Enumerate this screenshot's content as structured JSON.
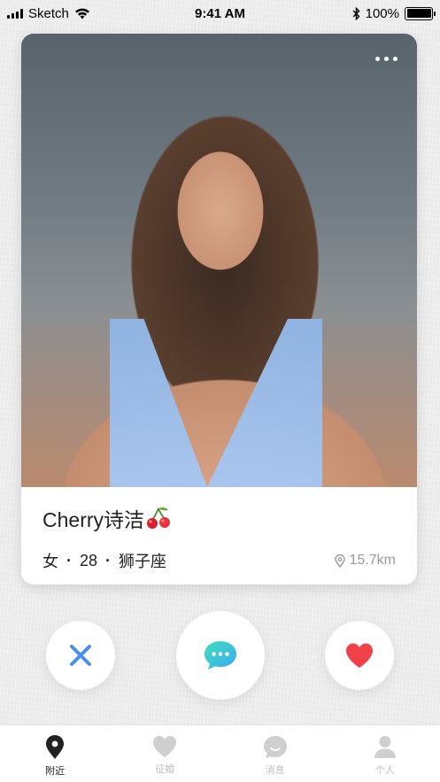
{
  "status_bar": {
    "carrier": "Sketch",
    "time": "9:41 AM",
    "battery": "100%"
  },
  "profile": {
    "name": "Cherry诗洁",
    "gender": "女",
    "age": "28",
    "zodiac": "狮子座",
    "separator": "·",
    "distance": "15.7km"
  },
  "tabs": [
    {
      "label": "附近",
      "icon": "location-pin-icon",
      "active": true
    },
    {
      "label": "征婚",
      "icon": "heart-icon",
      "active": false
    },
    {
      "label": "消息",
      "icon": "chat-bubble-icon",
      "active": false
    },
    {
      "label": "个人",
      "icon": "person-icon",
      "active": false
    }
  ],
  "colors": {
    "dislike": "#4a8ff0",
    "chat_from": "#3ee0b8",
    "chat_to": "#3aa8f5",
    "like": "#f0404a",
    "tab_active": "#222222",
    "tab_inactive": "#cfcfcf"
  }
}
